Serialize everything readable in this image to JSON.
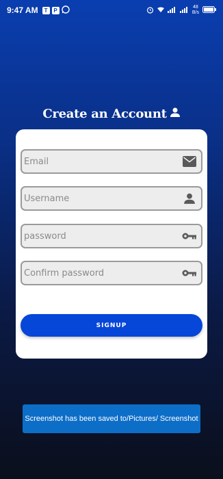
{
  "status_bar": {
    "time": "9:47 AM",
    "speed_value": "48",
    "speed_unit": "B/s",
    "app_icons": [
      "T",
      "P"
    ],
    "icons": [
      "teams-icon",
      "publisher-icon",
      "whatsapp-icon",
      "alarm-icon",
      "wifi-icon",
      "signal-icon",
      "signal-icon",
      "battery-icon"
    ]
  },
  "header": {
    "title": "Create an Account",
    "icon": "person-icon"
  },
  "form": {
    "email_placeholder": "Email",
    "username_placeholder": "Username",
    "password_placeholder": "password",
    "confirm_placeholder": "Confirm password",
    "email_icon": "mail-icon",
    "username_icon": "person-icon",
    "password_icon": "key-icon",
    "confirm_icon": "key-icon",
    "submit_label": "SIGNUP"
  },
  "toast": {
    "message": "Screenshot has been saved to/Pictures/ Screenshot"
  },
  "colors": {
    "accent": "#0646d8",
    "toast": "#0d6ec8",
    "background_top": "#0a3eb0",
    "background_bottom": "#0b0f1c"
  }
}
